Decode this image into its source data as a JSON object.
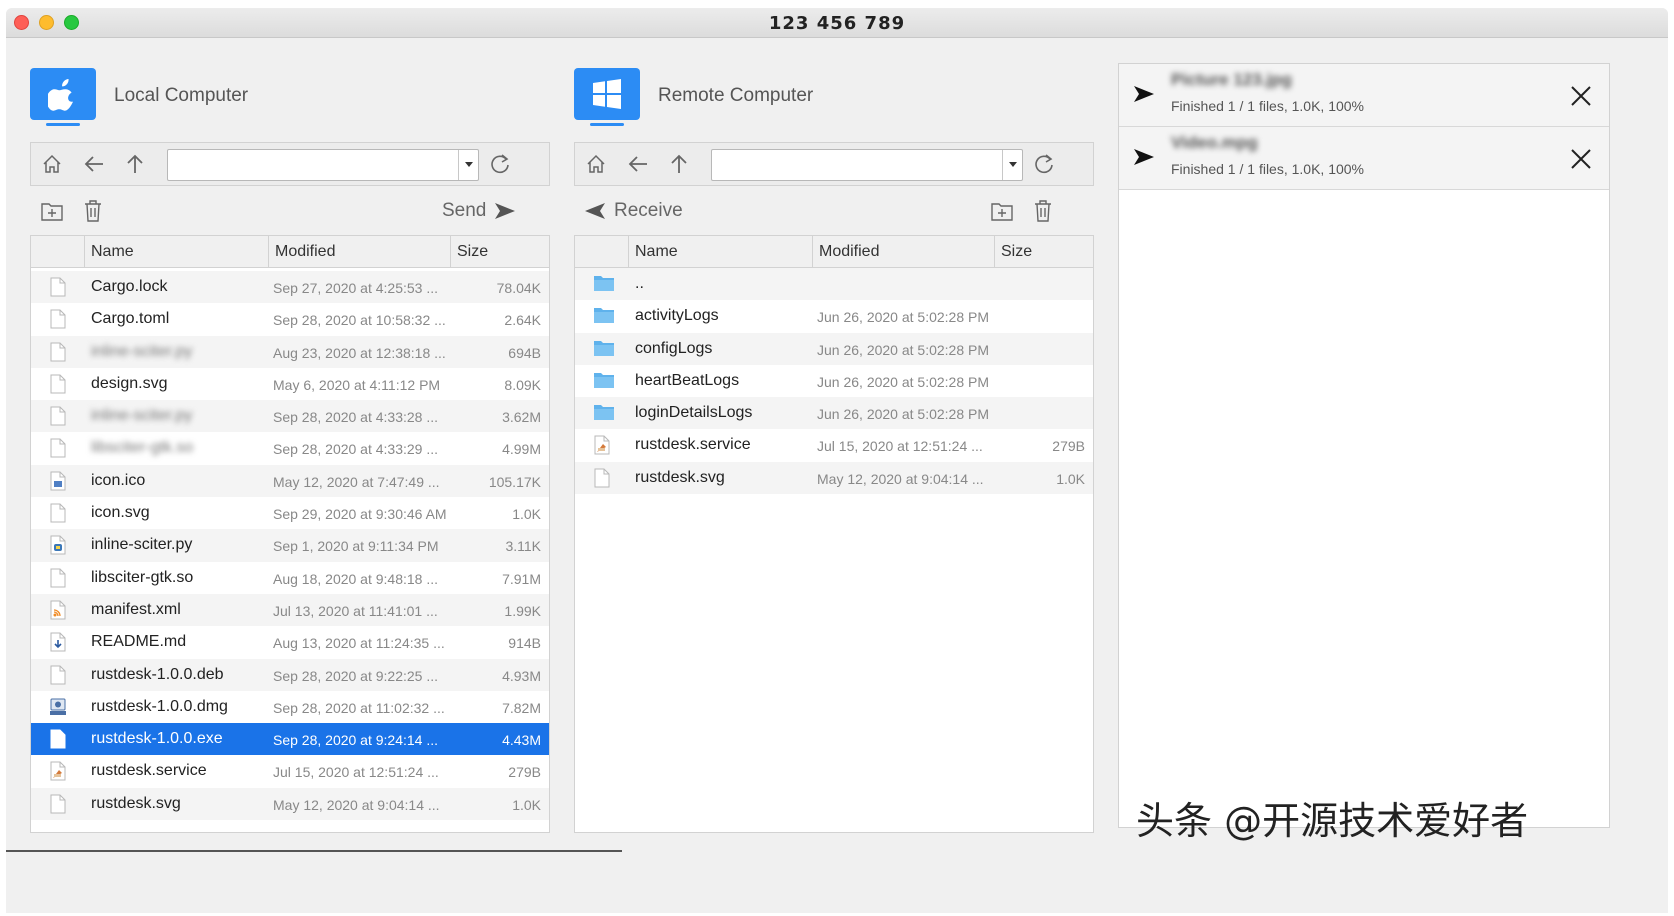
{
  "window": {
    "title": "123 456 789"
  },
  "local": {
    "title": "Local Computer",
    "os_icon": "apple-icon",
    "path": {
      "value": "",
      "placeholder": ""
    },
    "send_label": "Send",
    "columns": [
      "Name",
      "Modified",
      "Size"
    ],
    "files": [
      {
        "name": "Cargo.lock",
        "modified": "Sep 27, 2020 at 4:25:53 ...",
        "size": "78.04K",
        "icon": "file-icon",
        "blurred": false,
        "selected": false
      },
      {
        "name": "Cargo.toml",
        "modified": "Sep 28, 2020 at 10:58:32 ...",
        "size": "2.64K",
        "icon": "file-icon",
        "blurred": false,
        "selected": false
      },
      {
        "name": "inline-sciter.py",
        "modified": "Aug 23, 2020 at 12:38:18 ...",
        "size": "694B",
        "icon": "file-icon",
        "blurred": true,
        "selected": false
      },
      {
        "name": "design.svg",
        "modified": "May 6, 2020 at 4:11:12 PM",
        "size": "8.09K",
        "icon": "file-icon",
        "blurred": false,
        "selected": false
      },
      {
        "name": "inline-sciter.py",
        "modified": "Sep 28, 2020 at 4:33:28 ...",
        "size": "3.62M",
        "icon": "file-icon",
        "blurred": true,
        "selected": false
      },
      {
        "name": "libsciter-gtk.so",
        "modified": "Sep 28, 2020 at 4:33:29 ...",
        "size": "4.99M",
        "icon": "file-icon",
        "blurred": true,
        "selected": false
      },
      {
        "name": "icon.ico",
        "modified": "May 12, 2020 at 7:47:49 ...",
        "size": "105.17K",
        "icon": "image-file-icon",
        "blurred": false,
        "selected": false
      },
      {
        "name": "icon.svg",
        "modified": "Sep 29, 2020 at 9:30:46 AM",
        "size": "1.0K",
        "icon": "file-icon",
        "blurred": false,
        "selected": false
      },
      {
        "name": "inline-sciter.py",
        "modified": "Sep 1, 2020 at 9:11:34 PM",
        "size": "3.11K",
        "icon": "python-file-icon",
        "blurred": false,
        "selected": false
      },
      {
        "name": "libsciter-gtk.so",
        "modified": "Aug 18, 2020 at 9:48:18 ...",
        "size": "7.91M",
        "icon": "file-icon",
        "blurred": false,
        "selected": false
      },
      {
        "name": "manifest.xml",
        "modified": "Jul 13, 2020 at 11:41:01 ...",
        "size": "1.99K",
        "icon": "rss-file-icon",
        "blurred": false,
        "selected": false
      },
      {
        "name": "README.md",
        "modified": "Aug 13, 2020 at 11:24:35 ...",
        "size": "914B",
        "icon": "download-file-icon",
        "blurred": false,
        "selected": false
      },
      {
        "name": "rustdesk-1.0.0.deb",
        "modified": "Sep 28, 2020 at 9:22:25 ...",
        "size": "4.93M",
        "icon": "file-icon",
        "blurred": false,
        "selected": false
      },
      {
        "name": "rustdesk-1.0.0.dmg",
        "modified": "Sep 28, 2020 at 11:02:32 ...",
        "size": "7.82M",
        "icon": "disk-image-icon",
        "blurred": false,
        "selected": false
      },
      {
        "name": "rustdesk-1.0.0.exe",
        "modified": "Sep 28, 2020 at 9:24:14 ...",
        "size": "4.43M",
        "icon": "file-icon",
        "blurred": false,
        "selected": true
      },
      {
        "name": "rustdesk.service",
        "modified": "Jul 15, 2020 at 12:51:24 ...",
        "size": "279B",
        "icon": "script-file-icon",
        "blurred": false,
        "selected": false
      },
      {
        "name": "rustdesk.svg",
        "modified": "May 12, 2020 at 9:04:14 ...",
        "size": "1.0K",
        "icon": "file-icon",
        "blurred": false,
        "selected": false
      }
    ]
  },
  "remote": {
    "title": "Remote Computer",
    "os_icon": "windows-icon",
    "path": {
      "value": "",
      "placeholder": ""
    },
    "receive_label": "Receive",
    "columns": [
      "Name",
      "Modified",
      "Size"
    ],
    "files": [
      {
        "name": "..",
        "modified": "",
        "size": "",
        "icon": "folder-icon"
      },
      {
        "name": "activityLogs",
        "modified": "Jun 26, 2020 at 5:02:28 PM",
        "size": "",
        "icon": "folder-icon"
      },
      {
        "name": "configLogs",
        "modified": "Jun 26, 2020 at 5:02:28 PM",
        "size": "",
        "icon": "folder-icon"
      },
      {
        "name": "heartBeatLogs",
        "modified": "Jun 26, 2020 at 5:02:28 PM",
        "size": "",
        "icon": "folder-icon"
      },
      {
        "name": "loginDetailsLogs",
        "modified": "Jun 26, 2020 at 5:02:28 PM",
        "size": "",
        "icon": "folder-icon"
      },
      {
        "name": "rustdesk.service",
        "modified": "Jul 15, 2020 at 12:51:24 ...",
        "size": "279B",
        "icon": "script-file-icon"
      },
      {
        "name": "rustdesk.svg",
        "modified": "May 12, 2020 at 9:04:14 ...",
        "size": "1.0K",
        "icon": "file-icon"
      }
    ]
  },
  "jobs": [
    {
      "name": "Picture 123.jpg",
      "status": "Finished 1 / 1 files, 1.0K, 100%"
    },
    {
      "name": "Video.mpg",
      "status": "Finished 1 / 1 files, 1.0K, 100%"
    }
  ],
  "watermark": "头条 @开源技术爱好者",
  "colors": {
    "accent": "#1a73e8",
    "os_icon": "#2c8cf4"
  }
}
